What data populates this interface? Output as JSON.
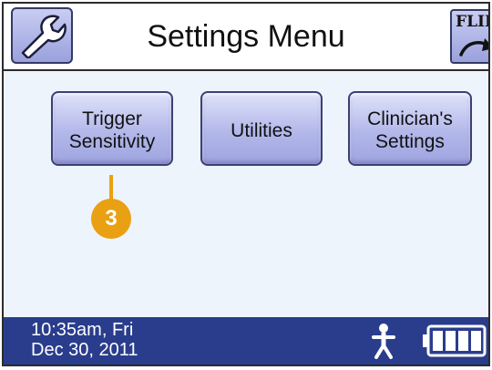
{
  "header": {
    "title": "Settings Menu",
    "flip_label": "FLIP",
    "wrench_icon": "wrench-icon",
    "flip_icon": "flip-arrow-icon"
  },
  "menu": {
    "buttons": [
      {
        "label": "Trigger\nSensitivity"
      },
      {
        "label": "Utilities"
      },
      {
        "label": "Clinician's\nSettings"
      }
    ]
  },
  "callout": {
    "number": "3",
    "color": "#e9a012"
  },
  "status": {
    "datetime": "10:35am, Fri\nDec 30, 2011",
    "patient_icon": "person-icon",
    "battery_icon": "battery-icon",
    "battery_bars": 4
  },
  "colors": {
    "status_bar": "#2a3d8c",
    "button_fill": "#b3b8ea",
    "screen_bg": "#eef4fb"
  }
}
